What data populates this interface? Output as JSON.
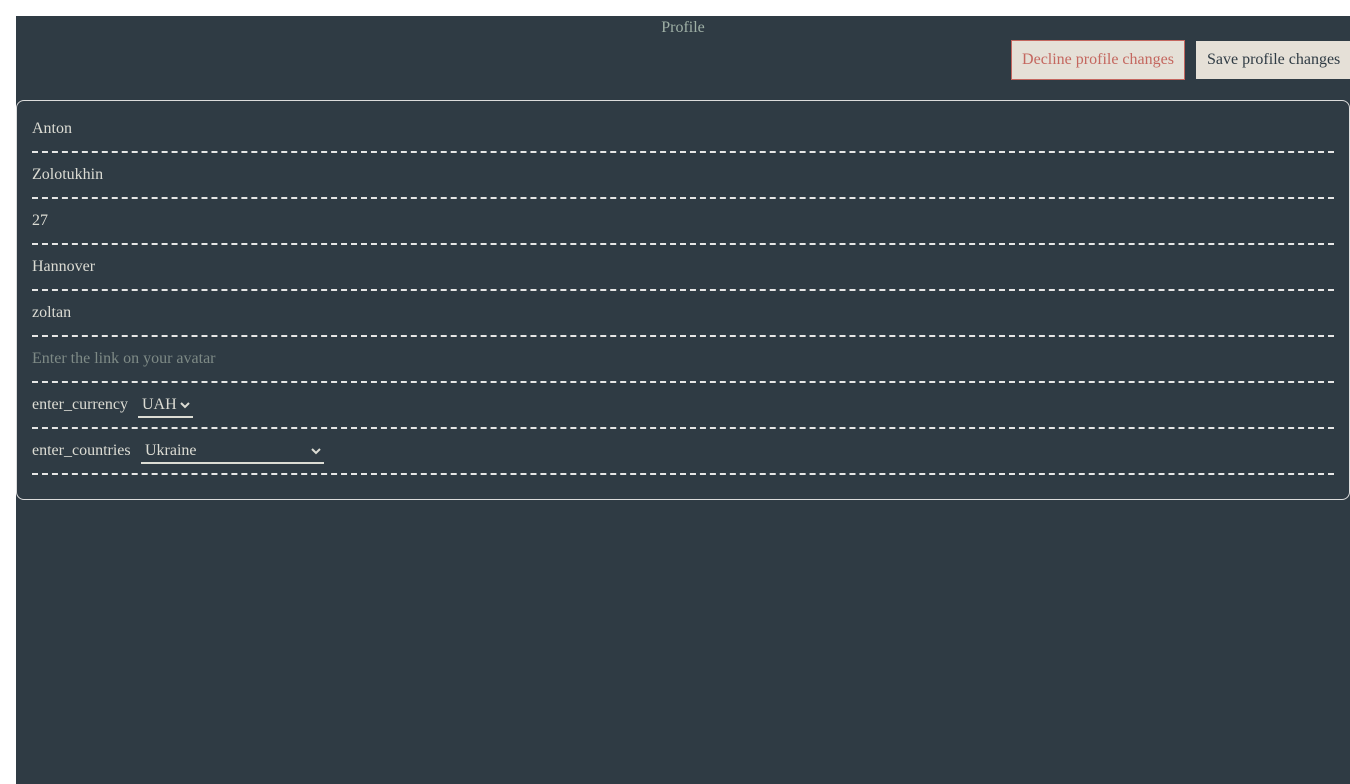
{
  "header": {
    "title": "Profile",
    "decline_label": "Decline profile changes",
    "save_label": "Save profile changes"
  },
  "form": {
    "first_name": {
      "value": "Anton"
    },
    "last_name": {
      "value": "Zolotukhin"
    },
    "age": {
      "value": "27"
    },
    "city": {
      "value": "Hannover"
    },
    "username": {
      "value": "zoltan"
    },
    "avatar": {
      "value": "",
      "placeholder": "Enter the link on your avatar"
    },
    "currency": {
      "label": "enter_currency",
      "selected": "UAH"
    },
    "country": {
      "label": "enter_countries",
      "selected": "Ukraine"
    }
  },
  "colors": {
    "background": "#2f3b44",
    "text": "#dcdcd4",
    "decline": "#c4675f",
    "button_bg": "#e5e0d7"
  }
}
